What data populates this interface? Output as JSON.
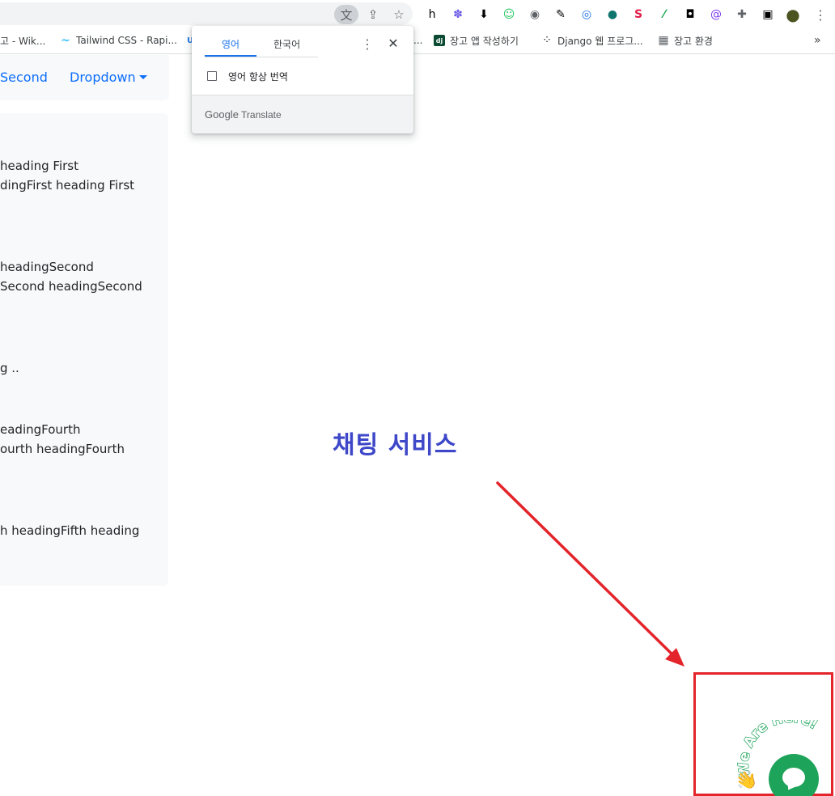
{
  "toolbar": {
    "omnibox_actions": [
      {
        "name": "translate-icon",
        "glyph": "文"
      },
      {
        "name": "share-icon",
        "glyph": "⇪"
      },
      {
        "name": "star-icon",
        "glyph": "☆"
      }
    ],
    "extensions": [
      {
        "name": "extension-h-icon",
        "glyph": "h",
        "color": "#202124"
      },
      {
        "name": "extension-gear-flower-icon",
        "glyph": "✽",
        "color": "#6c5ce7"
      },
      {
        "name": "extension-download-icon",
        "glyph": "⬇",
        "color": "#202124"
      },
      {
        "name": "extension-face-icon",
        "glyph": "☺",
        "color": "#22c55e"
      },
      {
        "name": "extension-camera-icon",
        "glyph": "◉",
        "color": "#5f6368"
      },
      {
        "name": "extension-eyedropper-icon",
        "glyph": "✎",
        "color": "#202124"
      },
      {
        "name": "extension-c-ring-icon",
        "glyph": "◎",
        "color": "#1a73e8"
      },
      {
        "name": "extension-chat-icon",
        "glyph": "●",
        "color": "#0f766e"
      },
      {
        "name": "extension-s-icon",
        "glyph": "S",
        "color": "#e11d48"
      },
      {
        "name": "extension-leaf-icon",
        "glyph": "⁄",
        "color": "#16a34a"
      },
      {
        "name": "extension-owl-icon",
        "glyph": "◘",
        "color": "#202124"
      },
      {
        "name": "extension-clip-icon",
        "glyph": "@",
        "color": "#7c3aed"
      },
      {
        "name": "extensions-puzzle-icon",
        "glyph": "✚",
        "color": "#5f6368"
      },
      {
        "name": "side-panel-icon",
        "glyph": "▣",
        "color": "#202124"
      },
      {
        "name": "profile-avatar-icon",
        "glyph": "●",
        "color": "#4b5320"
      },
      {
        "name": "more-menu-icon",
        "glyph": "⋮",
        "color": "#5f6368"
      }
    ]
  },
  "bookmarks": {
    "items": [
      {
        "label": "고 - Wik...",
        "icon": "",
        "icon_color": "#ffffff"
      },
      {
        "label": "Tailwind CSS - Rapi...",
        "icon": "~",
        "icon_color": "#38bdf8"
      },
      {
        "label": "",
        "icon": "U",
        "icon_color": "#1a73e8"
      },
      {
        "label": "...",
        "icon": "",
        "icon_color": "#ffffff"
      },
      {
        "label": "장고 앱 작성하기",
        "icon": "dj",
        "icon_color": "#0c4b33"
      },
      {
        "label": "Django 웹 프로그...",
        "icon": "⁘",
        "icon_color": "#202124"
      },
      {
        "label": "장고 환경",
        "icon": "▦",
        "icon_color": "#5f6368"
      }
    ],
    "overflow": "»"
  },
  "translate_popup": {
    "tab_source": "영어",
    "tab_target": "한국어",
    "menu_icon": "⋮",
    "close_icon": "✕",
    "always_translate_label": "영어 항상 번역",
    "footer_google": "Google",
    "footer_translate": "Translate"
  },
  "navbar": {
    "second": "Second",
    "dropdown": "Dropdown"
  },
  "accordion": {
    "lines": [
      " heading First",
      "dingFirst heading First",
      "headingSecond",
      " Second headingSecond",
      "g ..",
      "eadingFourth",
      "ourth headingFourth",
      "h headingFifth heading"
    ]
  },
  "annotation": {
    "title": "채팅 서비스",
    "arrow_color": "#e3242b",
    "box_color": "#e3242b",
    "title_color": "#3d47c8"
  },
  "chat_widget": {
    "badge_text": "We Are Here!",
    "wave_emoji": "👋",
    "button_color": "#1ea35a"
  }
}
